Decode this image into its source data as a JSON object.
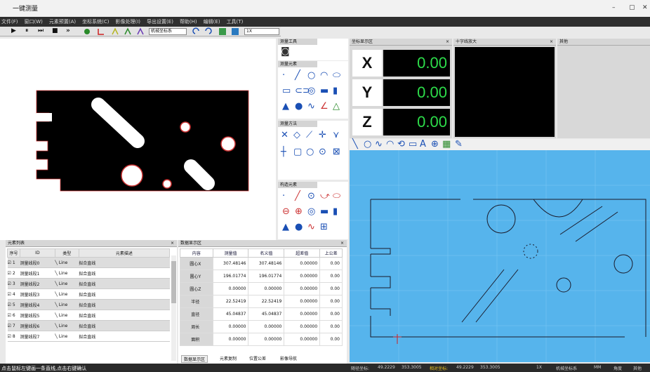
{
  "app": {
    "title": "一键测量",
    "win_min": "–",
    "win_max": "▢",
    "win_close": "✕"
  },
  "menu": [
    "文件(F)",
    "窗口(W)",
    "元素预置(A)",
    "坐标系统(C)",
    "影像处理(I)",
    "导出设置(E)",
    "帮助(H)",
    "编辑(E)",
    "工具(T)"
  ],
  "toolbar": {
    "play": "▶",
    "pause": "⏸",
    "step": "⏭",
    "stop": "■",
    "ff": "»",
    "coord_mode": "机械坐标系",
    "zoom": "1X"
  },
  "panels": {
    "tools_title": "测量工具",
    "elements_title": "测量元素",
    "methods_title": "测量方法",
    "construct_title": "构造元素",
    "coord_title": "坐标显示区",
    "cross_title": "十字线放大",
    "other_title": "其他",
    "elist_title": "元素列表",
    "data_title": "数据显示区",
    "close": "×"
  },
  "coords": {
    "x_label": "X",
    "y_label": "Y",
    "z_label": "Z",
    "x": "0.00",
    "y": "0.00",
    "z": "0.00"
  },
  "element_list": {
    "headers": [
      "序号",
      "ID",
      "类型",
      "元素描述"
    ],
    "rows": [
      {
        "no": "1",
        "id": "测量线段0",
        "type": "Line",
        "desc": "拟合直线"
      },
      {
        "no": "2",
        "id": "测量线段1",
        "type": "Line",
        "desc": "拟合直线"
      },
      {
        "no": "3",
        "id": "测量线段2",
        "type": "Line",
        "desc": "拟合直线"
      },
      {
        "no": "4",
        "id": "测量线段3",
        "type": "Line",
        "desc": "拟合直线"
      },
      {
        "no": "5",
        "id": "测量线段4",
        "type": "Line",
        "desc": "拟合直线"
      },
      {
        "no": "6",
        "id": "测量线段5",
        "type": "Line",
        "desc": "拟合直线"
      },
      {
        "no": "7",
        "id": "测量线段6",
        "type": "Line",
        "desc": "拟合直线"
      },
      {
        "no": "8",
        "id": "测量线段7",
        "type": "Line",
        "desc": "拟合直线"
      }
    ]
  },
  "data_table": {
    "headers": [
      "内容",
      "测量值",
      "名义值",
      "超差值",
      "上公差"
    ],
    "rows": [
      {
        "k": "圆心X",
        "m": "307.48146",
        "n": "307.48146",
        "d": "0.00000",
        "u": "0.00"
      },
      {
        "k": "圆心Y",
        "m": "196.01774",
        "n": "196.01774",
        "d": "0.00000",
        "u": "0.00"
      },
      {
        "k": "圆心Z",
        "m": "0.00000",
        "n": "0.00000",
        "d": "0.00000",
        "u": "0.00"
      },
      {
        "k": "半径",
        "m": "22.52419",
        "n": "22.52419",
        "d": "0.00000",
        "u": "0.00"
      },
      {
        "k": "直径",
        "m": "45.04837",
        "n": "45.04837",
        "d": "0.00000",
        "u": "0.00"
      },
      {
        "k": "周长",
        "m": "0.00000",
        "n": "0.00000",
        "d": "0.00000",
        "u": "0.00"
      },
      {
        "k": "面积",
        "m": "0.00000",
        "n": "0.00000",
        "d": "0.00000",
        "u": "0.00"
      }
    ],
    "tabs": [
      "数据显示区",
      "元素复制",
      "位置公差",
      "影像导航"
    ]
  },
  "status": {
    "hint": "点击鼠标左键画一条直线,点击右键确认",
    "pos_label": "随径坐标:",
    "pos_x": "49.2229",
    "pos_y": "353.3005",
    "rel_label": "相对坐标:",
    "rel_x": "49.2229",
    "rel_y": "353.3005",
    "zoom": "1X",
    "coord": "机械坐标系",
    "unit": "MM",
    "angle": "角度",
    "extra": "其他"
  },
  "colors": {
    "accent": "#1a4fb4",
    "cad_bg": "#56b4ec",
    "readout": "#2ddc4a"
  }
}
